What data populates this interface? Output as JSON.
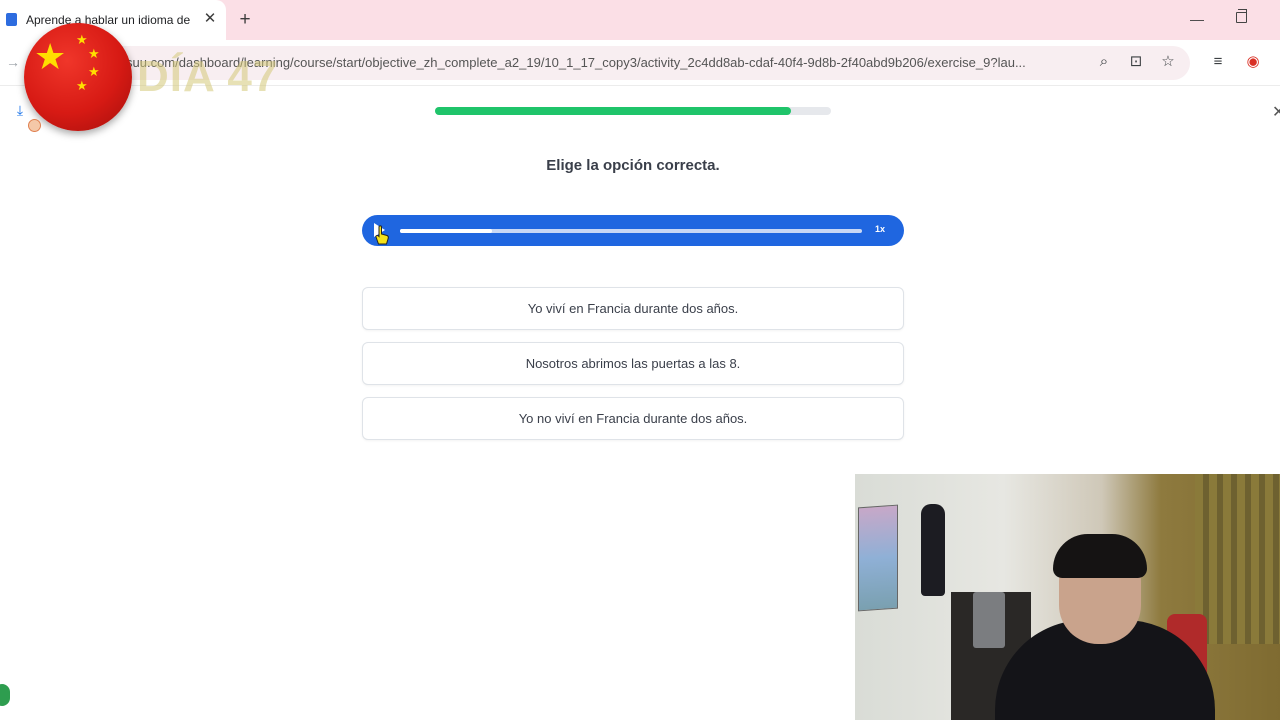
{
  "browser": {
    "tab_title": "Aprende a hablar un idioma de",
    "tab_close": "✕",
    "new_tab": "+",
    "url": "suu.com/dashboard/learning/course/start/objective_zh_complete_a2_19/10_1_17_copy3/activity_2c4dd8ab-cdaf-40f4-9d8b-2f40abd9b206/exercise_9?lau...",
    "window_min": "—"
  },
  "overlay": {
    "day_label": "DÍA 47"
  },
  "lesson": {
    "progress_fraction": 0.9,
    "instruction": "Elige la opción correcta.",
    "audio": {
      "speed": "1x",
      "progress_fraction": 0.2
    },
    "options": [
      "Yo viví en Francia durante dos años.",
      "Nosotros abrimos las puertas a las 8.",
      "Yo no viví en Francia durante dos años."
    ]
  },
  "colors": {
    "progress": "#1fc46a",
    "audio_player": "#1f66e0",
    "tabbar": "#fbdfe6"
  }
}
